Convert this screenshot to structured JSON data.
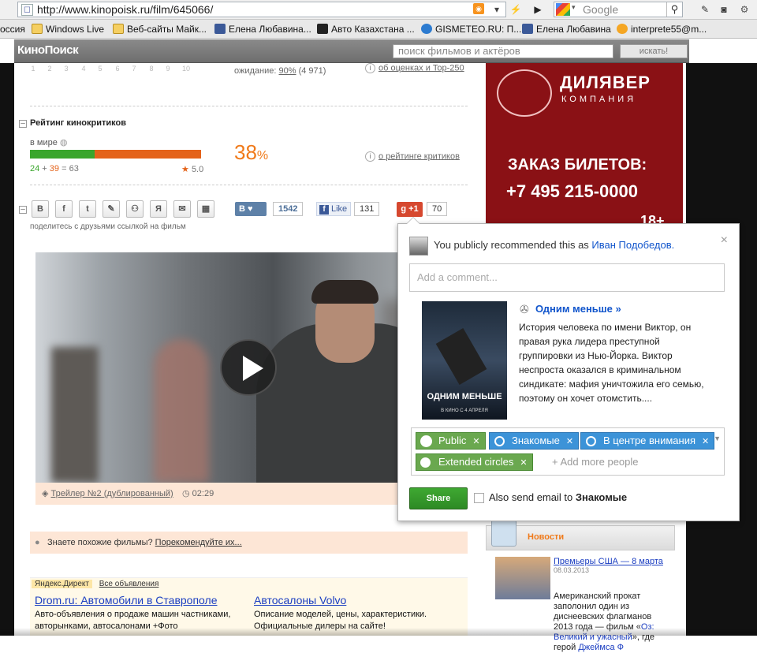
{
  "browser": {
    "url": "http://www.kinopoisk.ru/film/645066/",
    "search_placeholder": "Google",
    "bookmarks": [
      "оссия",
      "Windows Live",
      "Веб-сайты Майк...",
      "Елена Любавина...",
      "Авто Казахстана ...",
      "GISMETEO.RU: П...",
      "Елена Любавина",
      "interprete55@m..."
    ]
  },
  "site": {
    "logo": "КиноПоиск",
    "search_placeholder": "поиск фильмов и актёров",
    "search_button": "искать!"
  },
  "rating": {
    "star_numbers": [
      "1",
      "2",
      "3",
      "4",
      "5",
      "6",
      "7",
      "8",
      "9",
      "10"
    ],
    "wait_label": "ожидание:",
    "wait_pct": "90%",
    "wait_count": "(4 971)",
    "ratings_link": "об оценках и Top-250"
  },
  "critics": {
    "title": "Рейтинг кинокритиков",
    "world_label": "в мире",
    "positive": "24",
    "negative": "39",
    "total": "63",
    "avg": "5.0",
    "positive_share": 0.38,
    "percent": "38",
    "percent_sign": "%",
    "link": "о рейтинге критиков"
  },
  "share": {
    "caption": "поделитесь с друзьями ссылкой на фильм",
    "vk_label": "В",
    "vk_count": "1542",
    "fb_label": "Like",
    "fb_count": "131",
    "gplus_label": "+1",
    "gplus_count": "70"
  },
  "video": {
    "title": "Трейлер №2 (дублированный)",
    "duration": "02:29"
  },
  "similar": {
    "question": "Знаете похожие фильмы?",
    "link": "Порекомендуйте их..."
  },
  "direct": {
    "label": "Яндекс.Директ",
    "all_link": "Все объявления",
    "ads": [
      {
        "title": "Drom.ru: Автомобили в Ставрополе",
        "desc": "Авто-объявления о продаже машин частниками, авторынками, автосалонами +Фото"
      },
      {
        "title": "Автосалоны Volvo",
        "desc": "Описание моделей, цены, характеристики. Официальные дилеры на сайте!"
      }
    ]
  },
  "banner": {
    "brand": "ДИЛЯВЕР",
    "brand_sub": "КОМПАНИЯ",
    "line1": "ЗАКАЗ БИЛЕТОВ:",
    "phone": "+7 495 215-0000",
    "age": "18+"
  },
  "news": {
    "heading": "Новости",
    "title": "Премьеры США — 8 марта",
    "date": "08.03.2013",
    "text_before": "Американский прокат заполонил один из диснеевских флагманов 2013 года — фильм «",
    "text_link": "Оз: Великий и ужасный",
    "text_after": "», где герой ",
    "text_link2": "Джеймса Ф"
  },
  "gplus_popup": {
    "recommend_text": "You publicly recommended this as",
    "user_name": "Иван Подобедов.",
    "comment_placeholder": "Add a comment...",
    "poster_title": "ОДНИМ МЕНЬШЕ",
    "poster_subtitle": "В КИНО С 4 АПРЕЛЯ",
    "film_title": "Одним меньше »",
    "film_desc": "История человека по имени Виктор, он правая рука лидера преступной группировки из Нью-Йорка. Виктор неспроста оказался в криминальном синдикате: мафия уничтожила его семью, поэтому он хочет отомстить....",
    "circles": [
      "Public",
      "Знакомые",
      "В центре внимания",
      "Extended circles"
    ],
    "add_more": "+ Add more people",
    "share_button": "Share",
    "email_label": "Also send email to",
    "email_circle": "Знакомые"
  },
  "colors": {
    "critic_green": "#3aa62c",
    "critic_orange": "#e4631a",
    "gplus_red": "#d6482f",
    "banner_red": "#8a1115"
  }
}
